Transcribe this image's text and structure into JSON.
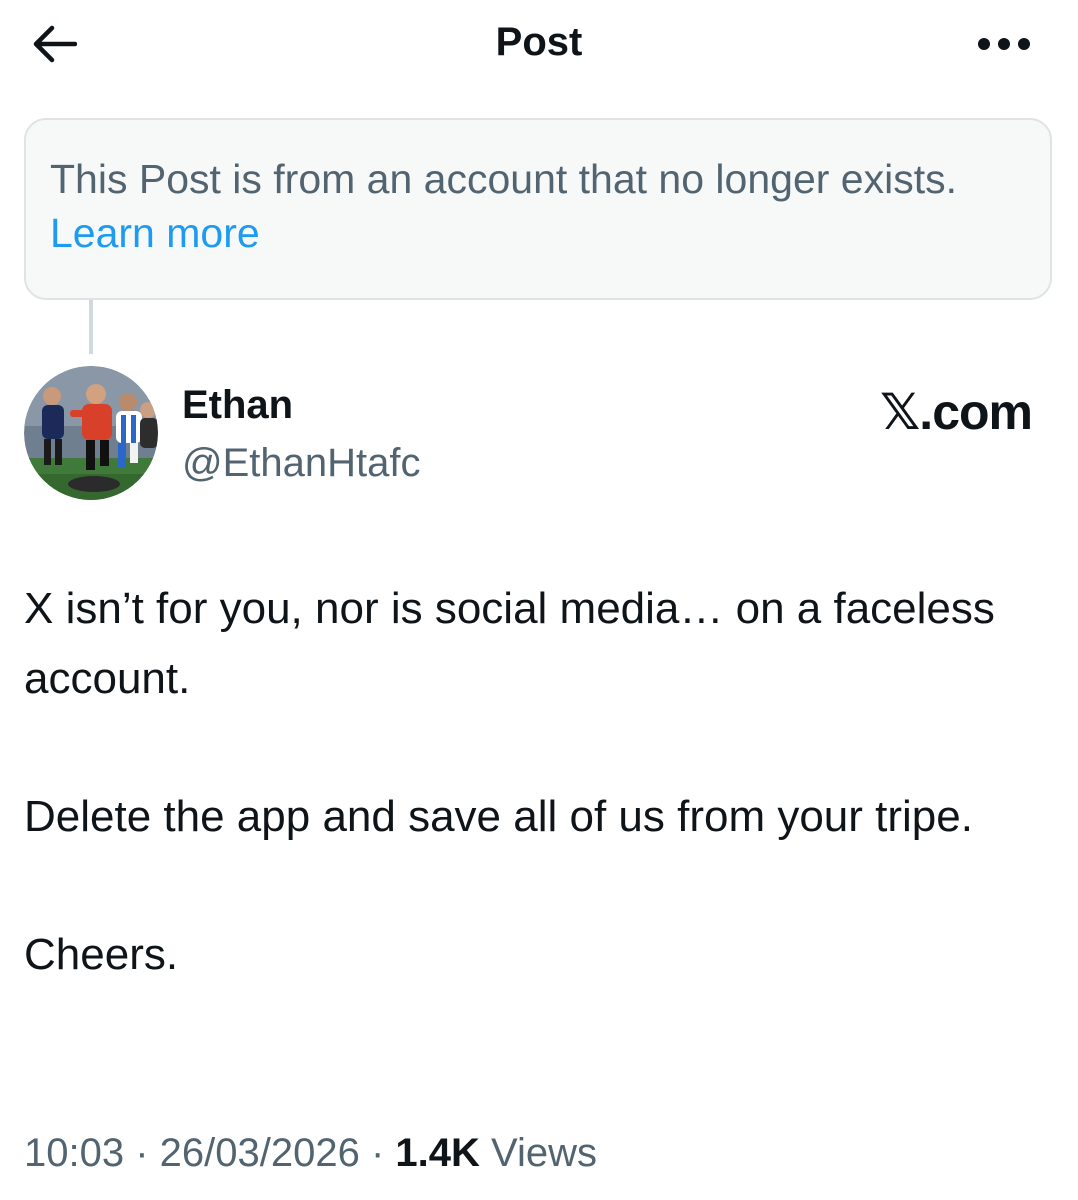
{
  "header": {
    "title": "Post",
    "back_icon": "arrow-left-icon",
    "more_icon": "ellipsis-horizontal-icon"
  },
  "notice": {
    "text": "This Post is from an account that no longer exists. ",
    "link_label": "Learn more"
  },
  "author": {
    "display_name": "Ethan",
    "handle": "@EthanHtafc",
    "avatar": "avatar-photo-football-match"
  },
  "watermark": "𝕏.com",
  "post": {
    "paragraphs": [
      "X isn’t for you, nor is social media… on a faceless account.",
      "Delete the app and save all of us from your tripe.",
      "Cheers."
    ]
  },
  "meta": {
    "time": "10:03",
    "separator": " · ",
    "date": "26/03/2026",
    "views_count": "1.4K",
    "views_label": "Views"
  },
  "colors": {
    "text_primary": "#0f1419",
    "text_secondary": "#536471",
    "link": "#1d9bf0",
    "notice_bg": "#f7f9f9",
    "border": "#dfe3e6"
  }
}
